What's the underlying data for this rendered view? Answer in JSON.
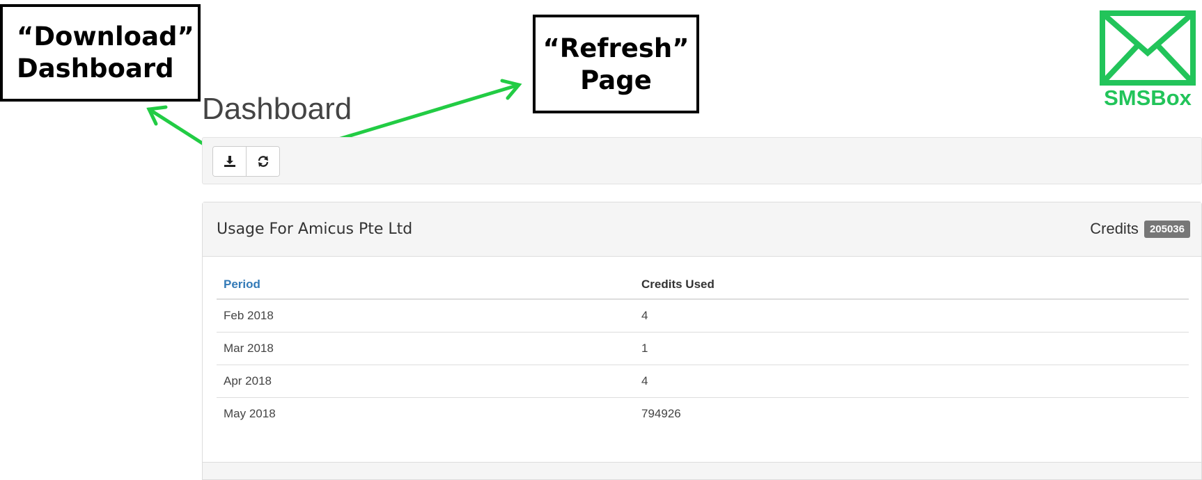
{
  "annotations": {
    "download": [
      "“Download”",
      "Dashboard"
    ],
    "refresh": [
      "“Refresh”",
      "Page"
    ],
    "arrow_color": "#22cc44"
  },
  "logo": {
    "text": "SMSBox",
    "color": "#22c45a",
    "icon": "envelope-icon"
  },
  "page": {
    "title": "Dashboard"
  },
  "toolbar": {
    "buttons": [
      {
        "icon": "download-icon"
      },
      {
        "icon": "refresh-icon"
      }
    ]
  },
  "usage_panel": {
    "title": "Usage For Amicus Pte Ltd",
    "credits_label": "Credits",
    "credits_value": "205036",
    "columns": [
      "Period",
      "Credits Used"
    ],
    "rows": [
      [
        "Feb 2018",
        "4"
      ],
      [
        "Mar 2018",
        "1"
      ],
      [
        "Apr 2018",
        "4"
      ],
      [
        "May 2018",
        "794926"
      ]
    ]
  }
}
